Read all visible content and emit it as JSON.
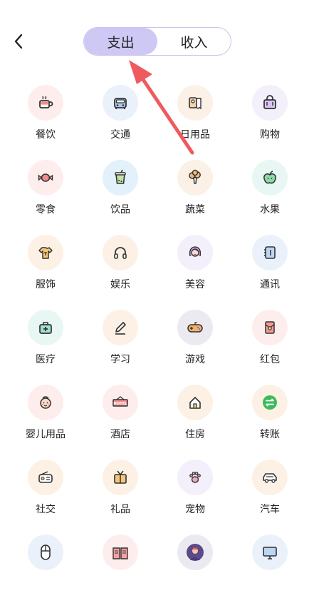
{
  "header": {
    "back_icon": "chevron-left-icon",
    "tabs": [
      {
        "label": "支出",
        "active": true
      },
      {
        "label": "收入",
        "active": false
      }
    ]
  },
  "colors": {
    "tab_active": "#cdc8f4",
    "tab_border": "#c9c3ef",
    "arrow": "#ef5a5f"
  },
  "categories": [
    {
      "label": "餐饮",
      "icon": "coffee-cup-icon",
      "bg": "#fdeeed"
    },
    {
      "label": "交通",
      "icon": "car-icon",
      "bg": "#eaf1fb"
    },
    {
      "label": "日用品",
      "icon": "tissue-roll-icon",
      "bg": "#fcf1e6"
    },
    {
      "label": "购物",
      "icon": "shopping-bag-icon",
      "bg": "#f3effb"
    },
    {
      "label": "零食",
      "icon": "candy-icon",
      "bg": "#fdeeed"
    },
    {
      "label": "饮品",
      "icon": "bubble-tea-icon",
      "bg": "#e3f1fb"
    },
    {
      "label": "蔬菜",
      "icon": "broccoli-icon",
      "bg": "#fcf1e6"
    },
    {
      "label": "水果",
      "icon": "apple-icon",
      "bg": "#e8f7f3"
    },
    {
      "label": "服饰",
      "icon": "t-shirt-icon",
      "bg": "#fdf1e6"
    },
    {
      "label": "娱乐",
      "icon": "headphones-icon",
      "bg": "#fdf1e6"
    },
    {
      "label": "美容",
      "icon": "woman-face-icon",
      "bg": "#f3effb"
    },
    {
      "label": "通讯",
      "icon": "phone-book-icon",
      "bg": "#eaf1fb"
    },
    {
      "label": "医疗",
      "icon": "medical-kit-icon",
      "bg": "#e8f7f3"
    },
    {
      "label": "学习",
      "icon": "pencil-icon",
      "bg": "#fdf1e6"
    },
    {
      "label": "游戏",
      "icon": "gamepad-icon",
      "bg": "#ebeaf0"
    },
    {
      "label": "红包",
      "icon": "red-envelope-icon",
      "bg": "#fdeeed"
    },
    {
      "label": "婴儿用品",
      "icon": "baby-face-icon",
      "bg": "#fdeeed"
    },
    {
      "label": "酒店",
      "icon": "hotel-sign-icon",
      "bg": "#fdeeed"
    },
    {
      "label": "住房",
      "icon": "house-icon",
      "bg": "#fdf1e6"
    },
    {
      "label": "转账",
      "icon": "transfer-icon",
      "bg": "#fdf1e6"
    },
    {
      "label": "社交",
      "icon": "radio-icon",
      "bg": "#fdf1e6"
    },
    {
      "label": "礼品",
      "icon": "gift-tv-icon",
      "bg": "#fdf1e6"
    },
    {
      "label": "宠物",
      "icon": "paw-icon",
      "bg": "#f3effb"
    },
    {
      "label": "汽车",
      "icon": "car-side-icon",
      "bg": "#fdf1e6"
    },
    {
      "label": "",
      "icon": "mouse-icon",
      "bg": "#eaf1fb"
    },
    {
      "label": "",
      "icon": "open-book-icon",
      "bg": "#fdeeed"
    },
    {
      "label": "",
      "icon": "person-avatar-icon",
      "bg": "#ebeaf0"
    },
    {
      "label": "",
      "icon": "monitor-icon",
      "bg": "#eaf1fb"
    }
  ]
}
